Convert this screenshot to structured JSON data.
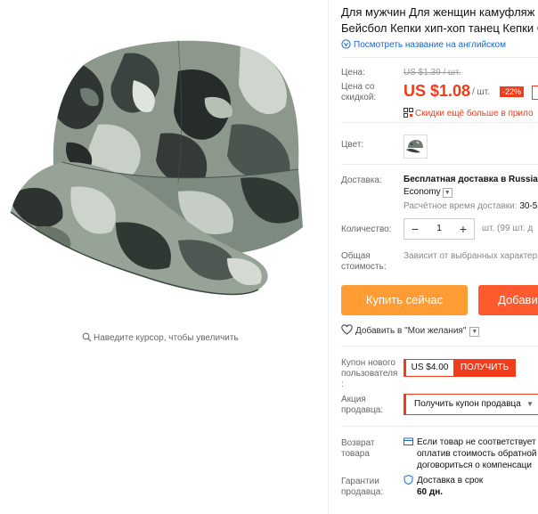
{
  "product": {
    "title_line1": "Для мужчин Для женщин камуфляж ш",
    "title_line2": "Бейсбол Кепки хип-хоп танец Кепки О",
    "translate_link": "Посмотреть название на английском",
    "translate_icon": "translate-icon"
  },
  "gallery": {
    "zoom_hint": "Наведите курсор, чтобы увеличить",
    "zoom_icon": "magnifier-icon"
  },
  "price": {
    "price_label": "Цена:",
    "old_price": "US $1.39 / шт.",
    "discount_label_1": "Цена со",
    "discount_label_2": "скидкой:",
    "new_price": "US $1.08",
    "per_unit": "/ шт.",
    "discount_badge": "-22%",
    "promo_text": "Скидки ещё больше в прило",
    "promo_icon": "qr-code-icon",
    "accent_color": "#f03c1a"
  },
  "color": {
    "label": "Цвет:"
  },
  "shipping": {
    "label": "Доставка:",
    "method": "Бесплатная доставка в Russian",
    "method_line2": "Economy",
    "time_label": "Расчётное время доставки:",
    "time_value": "30-5"
  },
  "quantity": {
    "label": "Количество:",
    "value": "1",
    "minus": "−",
    "plus": "+",
    "unit_note": "шт. (99 шт. д"
  },
  "total": {
    "label_1": "Общая",
    "label_2": "стоимость:",
    "value": "Зависит от выбранных характер"
  },
  "actions": {
    "buy_now": "Купить сейчас",
    "add_to_cart": "Добави",
    "wishlist": "Добавить в \"Мои желания\"",
    "buy_color": "#ff9c33",
    "cart_color": "#ff5a2e"
  },
  "coupons": {
    "new_user_label_1": "Купон нового",
    "new_user_label_2": "пользователя",
    "new_user_label_3": ":",
    "new_user_amount": "US $4.00",
    "get_button": "ПОЛУЧИТЬ",
    "seller_label_1": "Акция",
    "seller_label_2": "продавца:",
    "seller_dropdown": "Получить купон продавца"
  },
  "returns": {
    "label_1": "Возврат",
    "label_2": "товара",
    "line1": "Если товар не соответствует",
    "line2": "оплатив стоимость обратной",
    "line3": "договориться о компенсаци"
  },
  "guarantee": {
    "label_1": "Гарантии",
    "label_2": "продавца:",
    "line1": "Доставка в срок",
    "line2": "60 дн."
  }
}
